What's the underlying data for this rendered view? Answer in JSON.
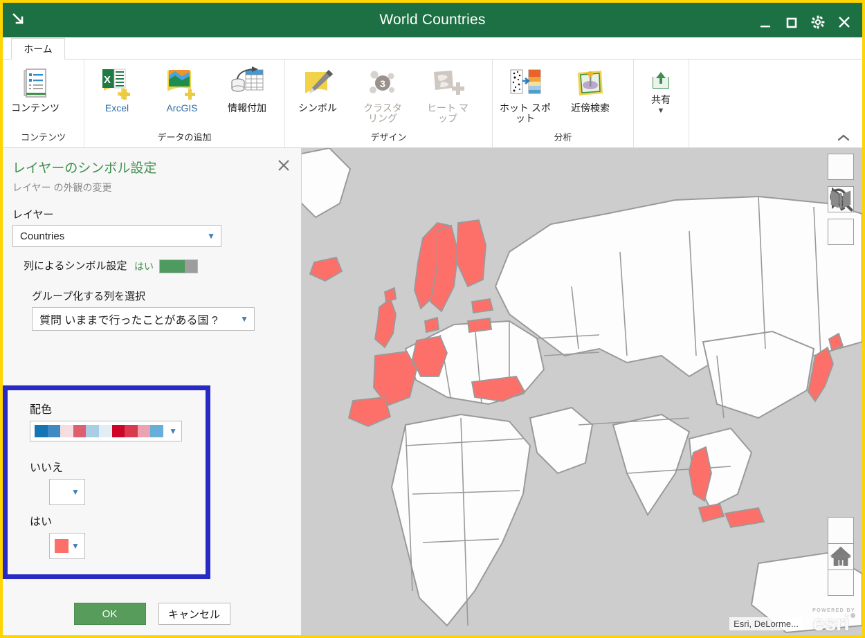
{
  "window": {
    "title": "World Countries",
    "dock_icon": "arrow-down-right-icon",
    "controls": [
      {
        "name": "minimize-button",
        "icon": "minimize-icon"
      },
      {
        "name": "maximize-button",
        "icon": "maximize-icon"
      },
      {
        "name": "settings-button",
        "icon": "gear-icon"
      },
      {
        "name": "close-button",
        "icon": "close-icon"
      }
    ]
  },
  "tabs": [
    {
      "label": "ホーム",
      "active": true
    }
  ],
  "ribbon": {
    "collapse_icon": "chevron-up-icon",
    "groups": [
      {
        "name": "contents",
        "label": "コンテンツ",
        "items": [
          {
            "label": "コンテンツ",
            "icon": "contents-document-icon",
            "disabled": false
          }
        ]
      },
      {
        "name": "add-data",
        "label": "データの追加",
        "items": [
          {
            "label": "Excel",
            "icon": "excel-add-icon",
            "disabled": false
          },
          {
            "label": "ArcGIS",
            "icon": "arcgis-add-icon",
            "disabled": false
          },
          {
            "label": "情報付加",
            "icon": "enrich-data-icon",
            "disabled": false
          }
        ]
      },
      {
        "name": "design",
        "label": "デザイン",
        "items": [
          {
            "label": "シンボル",
            "icon": "symbol-brush-icon",
            "disabled": false
          },
          {
            "label": "クラスタリング",
            "icon": "clustering-icon",
            "disabled": true
          },
          {
            "label": "ヒート マップ",
            "icon": "heatmap-icon",
            "disabled": true
          }
        ]
      },
      {
        "name": "analysis",
        "label": "分析",
        "items": [
          {
            "label": "ホット スポット",
            "icon": "hotspot-icon",
            "disabled": false
          },
          {
            "label": "近傍検索",
            "icon": "proximity-search-icon",
            "disabled": false
          }
        ]
      },
      {
        "name": "share",
        "label": "",
        "items": [
          {
            "label": "共有",
            "icon": "share-upload-icon",
            "disabled": false,
            "caret": "▼"
          }
        ]
      }
    ]
  },
  "panel": {
    "title": "レイヤーのシンボル設定",
    "subtitle": "レイヤー の外観の変更",
    "close_icon": "close-icon",
    "layer_label": "レイヤー",
    "layer_value": "Countries",
    "symbol_by_column_label": "列によるシンボル設定",
    "symbol_by_column_state": "はい",
    "group_column_label": "グループ化する列を選択",
    "group_column_value": "質問 いままで行ったことがある国 ?",
    "color_scheme_label": "配色",
    "color_ramp": [
      "#1474b4",
      "#3e8bc4",
      "#f6dde1",
      "#dd6072",
      "#a8cde4",
      "#e2eef6",
      "#ce0429",
      "#d93a4e",
      "#eda3af",
      "#67aed8"
    ],
    "categories": [
      {
        "label": "いいえ",
        "color": "#ffffff"
      },
      {
        "label": "はい",
        "color": "#fc7069"
      }
    ],
    "ok_label": "OK",
    "cancel_label": "キャンセル"
  },
  "map": {
    "tools_top": [
      {
        "name": "search-tool",
        "icon": "search-icon"
      },
      {
        "name": "select-tool",
        "icon": "cursor-arrow-icon"
      },
      {
        "name": "basemap-tool",
        "icon": "basemap-book-icon"
      }
    ],
    "tools_bottom": [
      {
        "name": "zoom-in-button",
        "icon": "plus-icon",
        "label": "+"
      },
      {
        "name": "home-extent-button",
        "icon": "home-icon"
      },
      {
        "name": "zoom-out-button",
        "icon": "minus-icon",
        "label": "−"
      }
    ],
    "attribution": "Esri, DeLorme...",
    "logo_powered": "POWERED BY",
    "logo_word": "esri",
    "ocean_color": "#cdcdcd",
    "land_color": "#fdfdfd",
    "border_color": "#9a9a9a",
    "highlight_color": "#fc7069"
  }
}
